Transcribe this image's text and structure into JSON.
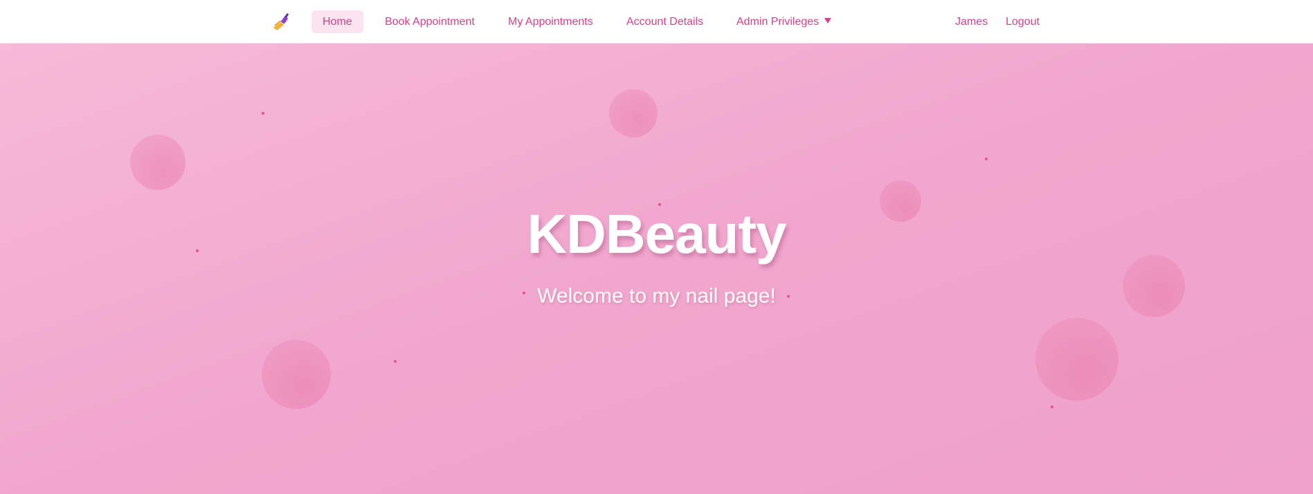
{
  "navbar": {
    "logo_icon": "nail-polish-icon",
    "items": [
      {
        "label": "Home",
        "active": true
      },
      {
        "label": "Book Appointment"
      },
      {
        "label": "My Appointments"
      },
      {
        "label": "Account Details"
      },
      {
        "label": "Admin Privileges",
        "has_dropdown": true
      }
    ],
    "user_name": "James",
    "logout_label": "Logout"
  },
  "hero": {
    "title": "KDBeauty",
    "subtitle": "Welcome to my nail page!"
  },
  "colors": {
    "accent": "#d6418a",
    "hero_bg": "#f1a6cd",
    "active_nav_bg": "#fbe4f0"
  }
}
